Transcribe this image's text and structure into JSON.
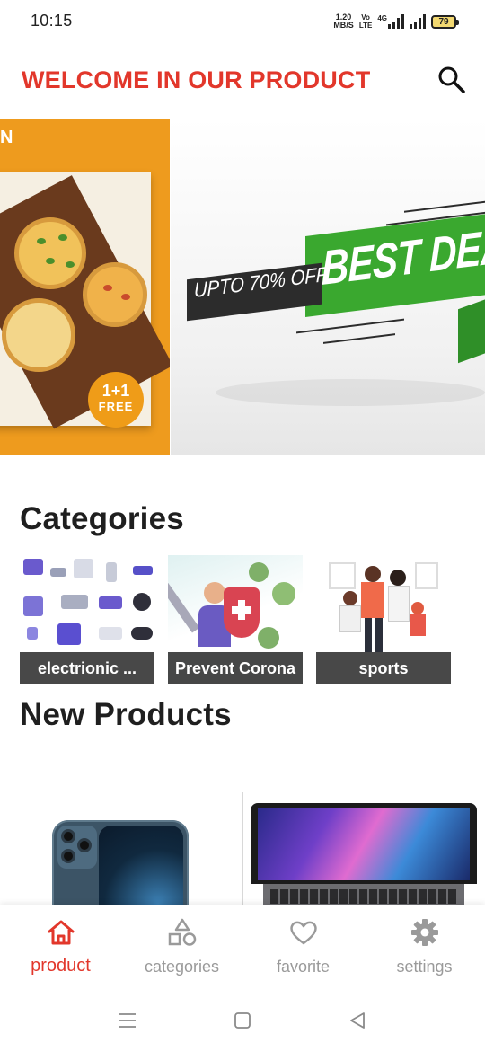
{
  "status_bar": {
    "time": "10:15",
    "net_speed_value": "1.20",
    "net_speed_unit": "MB/S",
    "volte_top": "Vo",
    "volte_bottom": "LTE",
    "network_type": "4G",
    "battery_level": "79"
  },
  "app_bar": {
    "title": "WELCOME IN OUR PRODUCT",
    "search_icon": "search-icon"
  },
  "banner": {
    "slides": [
      {
        "name": "pizza-offer",
        "edge_text": "N",
        "badge_line1": "1+1",
        "badge_line2": "FREE"
      },
      {
        "name": "best-deal",
        "off_text": "UPTO 70% OFF",
        "headline": "BEST DEA"
      }
    ]
  },
  "categories": {
    "title": "Categories",
    "items": [
      {
        "label": "electrionic ..."
      },
      {
        "label": "Prevent Corona"
      },
      {
        "label": "sports"
      }
    ]
  },
  "new_products": {
    "title": "New Products"
  },
  "bottom_nav": {
    "items": [
      {
        "label": "product",
        "icon": "home-icon",
        "active": true
      },
      {
        "label": "categories",
        "icon": "shapes-icon",
        "active": false
      },
      {
        "label": "favorite",
        "icon": "heart-icon",
        "active": false
      },
      {
        "label": "settings",
        "icon": "gear-icon",
        "active": false
      }
    ]
  },
  "colors": {
    "accent": "#e2372b",
    "inactive": "#9a9a9a"
  }
}
